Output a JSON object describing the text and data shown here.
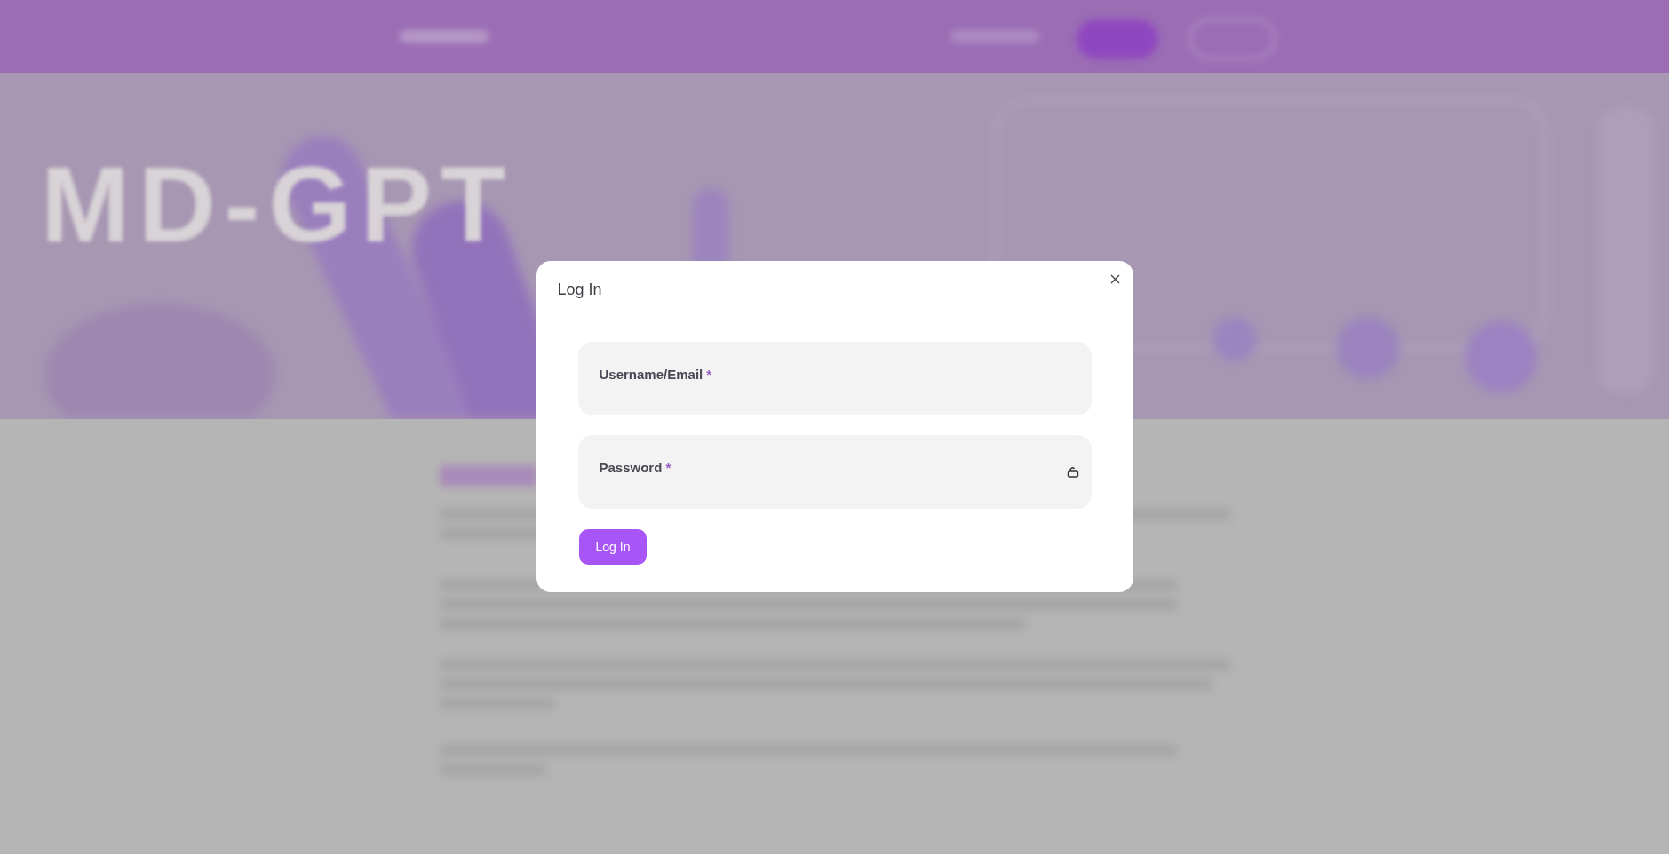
{
  "background": {
    "hero_title": "MD-GPT"
  },
  "dialog": {
    "title": "Log In",
    "fields": [
      {
        "label": "Username/Email",
        "required_mark": "*",
        "kind": "text"
      },
      {
        "label": "Password",
        "required_mark": "*",
        "kind": "password"
      }
    ],
    "submit": "Log In"
  }
}
